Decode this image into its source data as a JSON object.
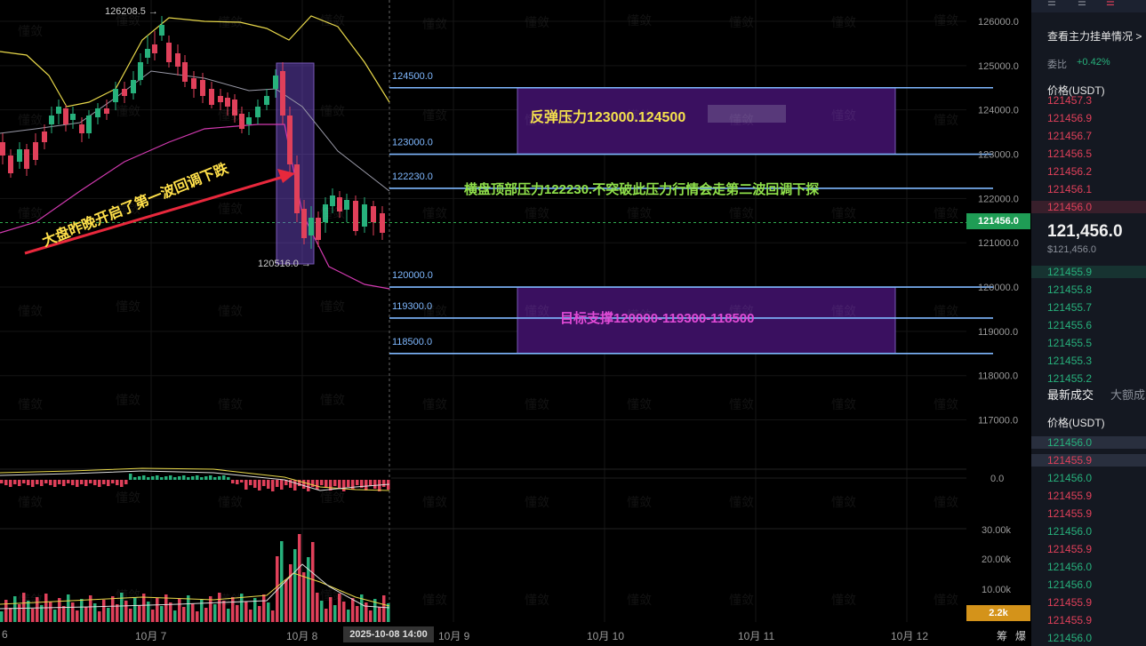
{
  "chart": {
    "high_label": "126208.5 →",
    "low_label": "120516.0 →",
    "price_axis": [
      "126000.0",
      "125000.0",
      "124000.0",
      "123000.0",
      "122000.0",
      "121000.0",
      "120000.0",
      "119000.0",
      "118000.0",
      "117000.0"
    ],
    "current_price_tag": "121456.0",
    "macd_zero": "0.0",
    "volume_axis": [
      "30.00k",
      "20.00k",
      "10.00k"
    ],
    "volume_tag": "2.2k",
    "levels": [
      {
        "value": 124500,
        "label": "124500.0"
      },
      {
        "value": 123000,
        "label": "123000.0"
      },
      {
        "value": 122230,
        "label": "122230.0"
      },
      {
        "value": 120000,
        "label": "120000.0"
      },
      {
        "value": 119300,
        "label": "119300.0"
      },
      {
        "value": 118500,
        "label": "118500.0"
      }
    ],
    "dates": [
      "6",
      "10月 7",
      "10月 8",
      "10月 9",
      "10月 10",
      "10月 11",
      "10月 12"
    ],
    "current_date": "2025-10-08 14:00",
    "bottom_right": [
      "筹",
      "爆"
    ],
    "watermark": "懂敛",
    "colors": {
      "up": "#27b17c",
      "down": "#e0405a",
      "level": "#7fb8ff",
      "zone": "#3a1060",
      "box": "#4a2a90"
    }
  },
  "annotations": {
    "rebound": "反弹压力123000.124500",
    "sideways": "横盘顶部压力122230.不突破此压力行情会走第二波回调下探",
    "support": "目标支撑120000-119300-118500",
    "arrow_note": "大盘昨晚开启了第一波回调下跌"
  },
  "sidebar": {
    "view_depth": "查看主力挂单情况",
    "ratio_label": "委比",
    "ratio_value": "+0.42%",
    "price_header": "价格(USDT)",
    "asks": [
      "121457.3",
      "121456.9",
      "121456.7",
      "121456.5",
      "121456.2",
      "121456.1",
      "121456.0"
    ],
    "last_price": "121,456.0",
    "last_price_usd": "$121,456.0",
    "bids": [
      "121455.9",
      "121455.8",
      "121455.7",
      "121455.6",
      "121455.5",
      "121455.3",
      "121455.2"
    ],
    "tabs": [
      "最新成交",
      "大额成"
    ],
    "trades_header": "价格(USDT)",
    "trades": [
      {
        "p": "121456.0",
        "s": "buy"
      },
      {
        "p": "121455.9",
        "s": "sell"
      },
      {
        "p": "121456.0",
        "s": "buy"
      },
      {
        "p": "121455.9",
        "s": "sell"
      },
      {
        "p": "121455.9",
        "s": "sell"
      },
      {
        "p": "121456.0",
        "s": "buy"
      },
      {
        "p": "121455.9",
        "s": "sell"
      },
      {
        "p": "121456.0",
        "s": "buy"
      },
      {
        "p": "121456.0",
        "s": "buy"
      },
      {
        "p": "121455.9",
        "s": "sell"
      },
      {
        "p": "121455.9",
        "s": "sell"
      },
      {
        "p": "121456.0",
        "s": "buy"
      }
    ]
  }
}
